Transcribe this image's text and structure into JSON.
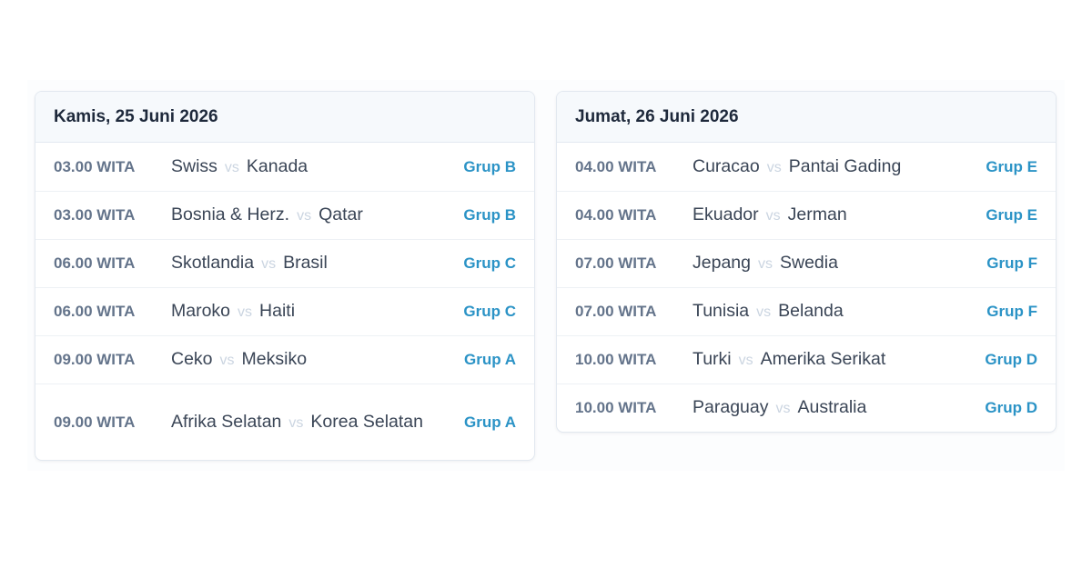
{
  "colors": {
    "group_accent": "#2b93c6",
    "time_text": "#64748b",
    "vs_text": "#cbd5e1",
    "header_bg": "#f6f9fc",
    "border": "#e2e8f0"
  },
  "days": [
    {
      "title": "Kamis, 25 Juni 2026",
      "matches": [
        {
          "time": "03.00 WITA",
          "home": "Swiss",
          "vs": "vs",
          "away": "Kanada",
          "group": "Grup B"
        },
        {
          "time": "03.00 WITA",
          "home": "Bosnia & Herz.",
          "vs": "vs",
          "away": "Qatar",
          "group": "Grup B"
        },
        {
          "time": "06.00 WITA",
          "home": "Skotlandia",
          "vs": "vs",
          "away": "Brasil",
          "group": "Grup C"
        },
        {
          "time": "06.00 WITA",
          "home": "Maroko",
          "vs": "vs",
          "away": "Haiti",
          "group": "Grup C"
        },
        {
          "time": "09.00 WITA",
          "home": "Ceko",
          "vs": "vs",
          "away": "Meksiko",
          "group": "Grup A"
        },
        {
          "time": "09.00 WITA",
          "home": "Afrika Selatan",
          "vs": "vs",
          "away": "Korea Selatan",
          "group": "Grup A"
        }
      ]
    },
    {
      "title": "Jumat, 26 Juni 2026",
      "matches": [
        {
          "time": "04.00 WITA",
          "home": "Curacao",
          "vs": "vs",
          "away": "Pantai Gading",
          "group": "Grup E"
        },
        {
          "time": "04.00 WITA",
          "home": "Ekuador",
          "vs": "vs",
          "away": "Jerman",
          "group": "Grup E"
        },
        {
          "time": "07.00 WITA",
          "home": "Jepang",
          "vs": "vs",
          "away": "Swedia",
          "group": "Grup F"
        },
        {
          "time": "07.00 WITA",
          "home": "Tunisia",
          "vs": "vs",
          "away": "Belanda",
          "group": "Grup F"
        },
        {
          "time": "10.00 WITA",
          "home": "Turki",
          "vs": "vs",
          "away": "Amerika Serikat",
          "group": "Grup D"
        },
        {
          "time": "10.00 WITA",
          "home": "Paraguay",
          "vs": "vs",
          "away": "Australia",
          "group": "Grup D"
        }
      ]
    }
  ]
}
